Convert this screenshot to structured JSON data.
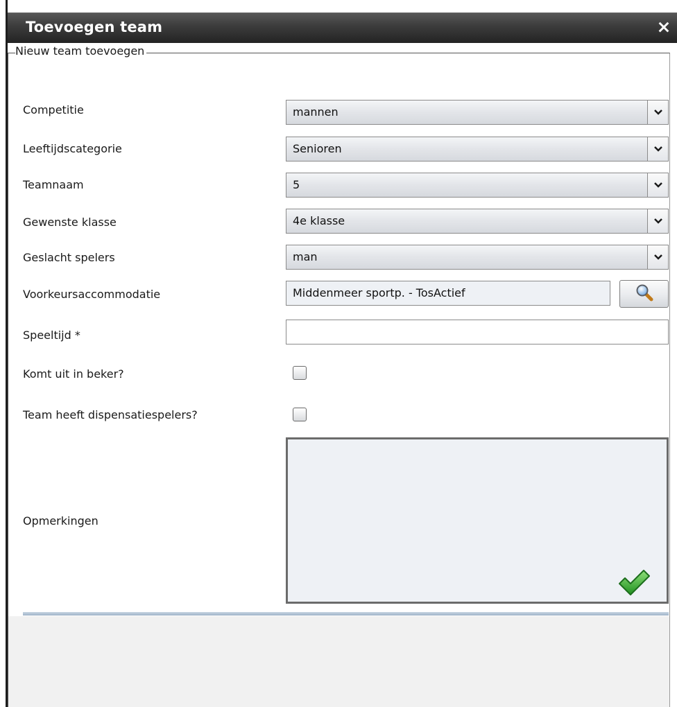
{
  "dialog": {
    "title": "Toevoegen team",
    "close_symbol": "×",
    "fieldset_legend": "Nieuw team toevoegen"
  },
  "form": {
    "competitie": {
      "label": "Competitie",
      "value": "mannen"
    },
    "leeftijdscategorie": {
      "label": "Leeftijdscategorie",
      "value": "Senioren"
    },
    "teamnaam": {
      "label": "Teamnaam",
      "value": "5"
    },
    "gewenste_klasse": {
      "label": "Gewenste klasse",
      "value": "4e klasse"
    },
    "geslacht_spelers": {
      "label": "Geslacht spelers",
      "value": "man"
    },
    "voorkeursaccommodatie": {
      "label": "Voorkeursaccommodatie",
      "value": "Middenmeer sportp. - TosActief",
      "button_icon": "magnifier-icon"
    },
    "speeltijd": {
      "label": "Speeltijd *",
      "value": ""
    },
    "komt_uit_in_beker": {
      "label": "Komt uit in beker?",
      "checked": false
    },
    "dispensatiespelers": {
      "label": "Team heeft dispensatiespelers?",
      "checked": false
    },
    "opmerkingen": {
      "label": "Opmerkingen",
      "value": ""
    }
  },
  "actions": {
    "submit_icon": "checkmark-icon"
  },
  "colors": {
    "titlebar": "#333333",
    "accent_green": "#2faa2f",
    "separator": "#a9bccf"
  }
}
